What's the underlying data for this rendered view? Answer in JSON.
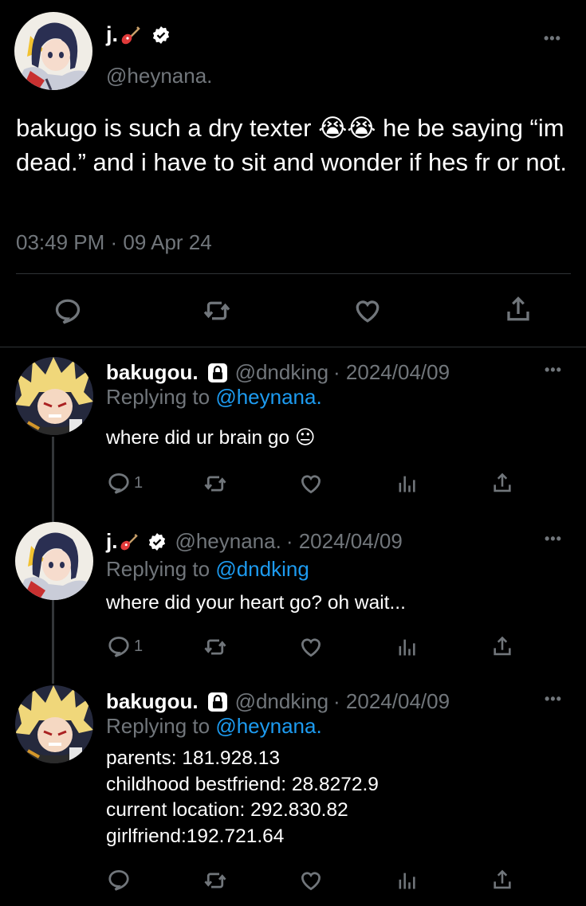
{
  "main_tweet": {
    "display_name": "j.",
    "handle": "@heynana.",
    "text": "bakugo is such a dry texter 😭😭  he be saying “im dead.” and i have to sit and wonder if hes fr or not.",
    "timestamp": "03:49 PM · 09 Apr 24",
    "more_label": "•••"
  },
  "replies": [
    {
      "display_name": "bakugou.",
      "handle": "@dndking",
      "date": "· 2024/04/09",
      "replying_prefix": "Replying to",
      "replying_to": "@heynana.",
      "text_lines": [
        "where did ur brain go 😐"
      ],
      "reply_count": "1",
      "more_label": "•••"
    },
    {
      "display_name": "j.",
      "handle": "@heynana.",
      "date": "· 2024/04/09",
      "replying_prefix": "Replying to",
      "replying_to": "@dndking",
      "text_lines": [
        "where did your heart go? oh wait..."
      ],
      "reply_count": "1",
      "more_label": "•••"
    },
    {
      "display_name": "bakugou.",
      "handle": "@dndking",
      "date": "· 2024/04/09",
      "replying_prefix": "Replying to",
      "replying_to": "@heynana.",
      "text_lines": [
        "parents: 181.928.13",
        "childhood bestfriend: 28.8272.9",
        "current location: 292.830.82",
        "girlfriend:192.721.64"
      ],
      "reply_count": "",
      "more_label": "•••"
    }
  ],
  "icons": {
    "reply": "reply-icon",
    "retweet": "retweet-icon",
    "like": "heart-icon",
    "views": "views-icon",
    "share": "share-icon",
    "verified": "verified-badge-icon",
    "protected": "lock-icon",
    "guitar": "guitar-emoji-icon"
  },
  "colors": {
    "background": "#000000",
    "text": "#e7e9ea",
    "muted": "#71767b",
    "link": "#1d9bf0",
    "divider": "#2f3336"
  }
}
